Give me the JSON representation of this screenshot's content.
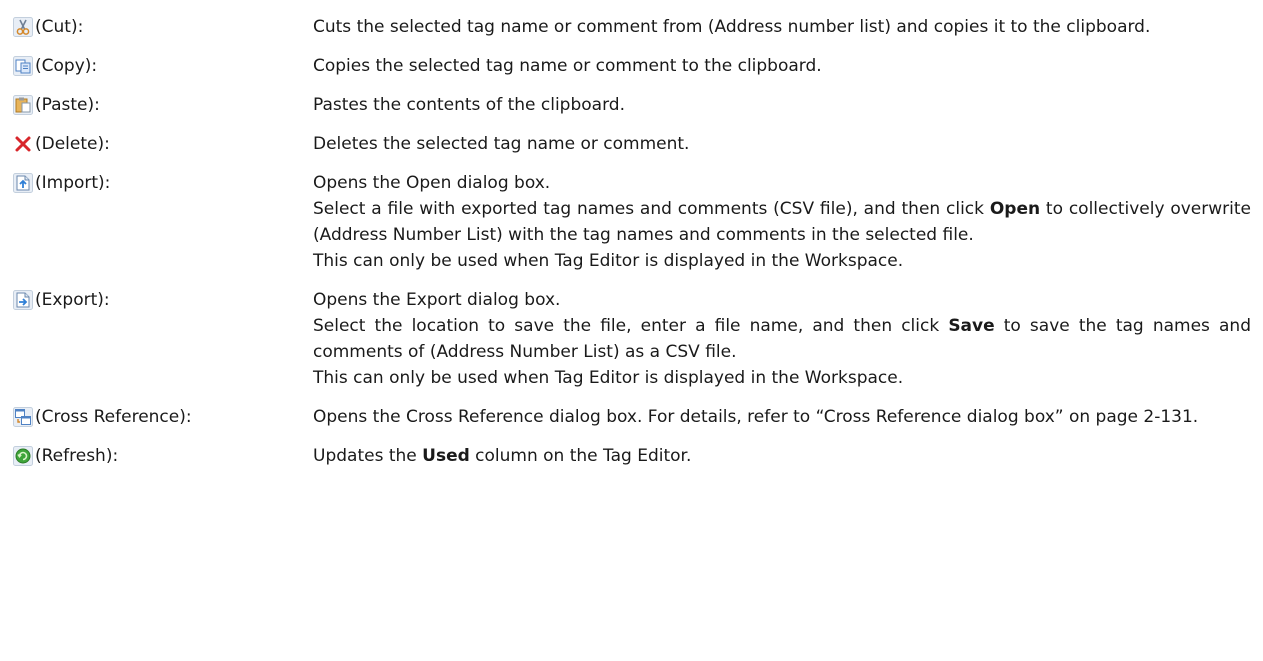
{
  "items": [
    {
      "icon": "scissors-icon",
      "term": "(Cut):",
      "lines": [
        [
          "Cuts the selected tag name or comment from (Address number list) and copies it to the clipboard."
        ]
      ]
    },
    {
      "icon": "copy-icon",
      "term": "(Copy):",
      "lines": [
        [
          "Copies the selected tag name or comment to the clipboard."
        ]
      ]
    },
    {
      "icon": "paste-icon",
      "term": "(Paste):",
      "lines": [
        [
          "Pastes the contents of the clipboard."
        ]
      ]
    },
    {
      "icon": "delete-x-icon",
      "term": "(Delete):",
      "lines": [
        [
          "Deletes the selected tag name or comment."
        ]
      ]
    },
    {
      "icon": "import-icon",
      "term": "(Import):",
      "lines": [
        [
          "Opens the Open dialog box."
        ],
        [
          "Select a file with exported tag names and comments (CSV file), and then click ",
          "Open",
          " to collectively overwrite (Address Number List) with the tag names and comments in the selected file."
        ],
        [
          "This can only be used when Tag Editor is displayed in the Workspace."
        ]
      ]
    },
    {
      "icon": "export-icon",
      "term": "(Export):",
      "lines": [
        [
          "Opens the Export dialog box."
        ],
        [
          "Select the location to save the file, enter a file name, and then click ",
          "Save",
          " to save the tag names and comments of (Address Number List) as a CSV file."
        ],
        [
          "This can only be used when Tag Editor is displayed in the Workspace."
        ]
      ]
    },
    {
      "icon": "cross-reference-icon",
      "term": "(Cross Reference):",
      "lines": [
        [
          "Opens the Cross Reference dialog box. For details, refer to “Cross Reference dialog box” on page 2-131."
        ]
      ]
    },
    {
      "icon": "refresh-icon",
      "term": "(Refresh):",
      "lines": [
        [
          "Updates the ",
          "Used",
          " column on the Tag Editor."
        ]
      ]
    }
  ]
}
